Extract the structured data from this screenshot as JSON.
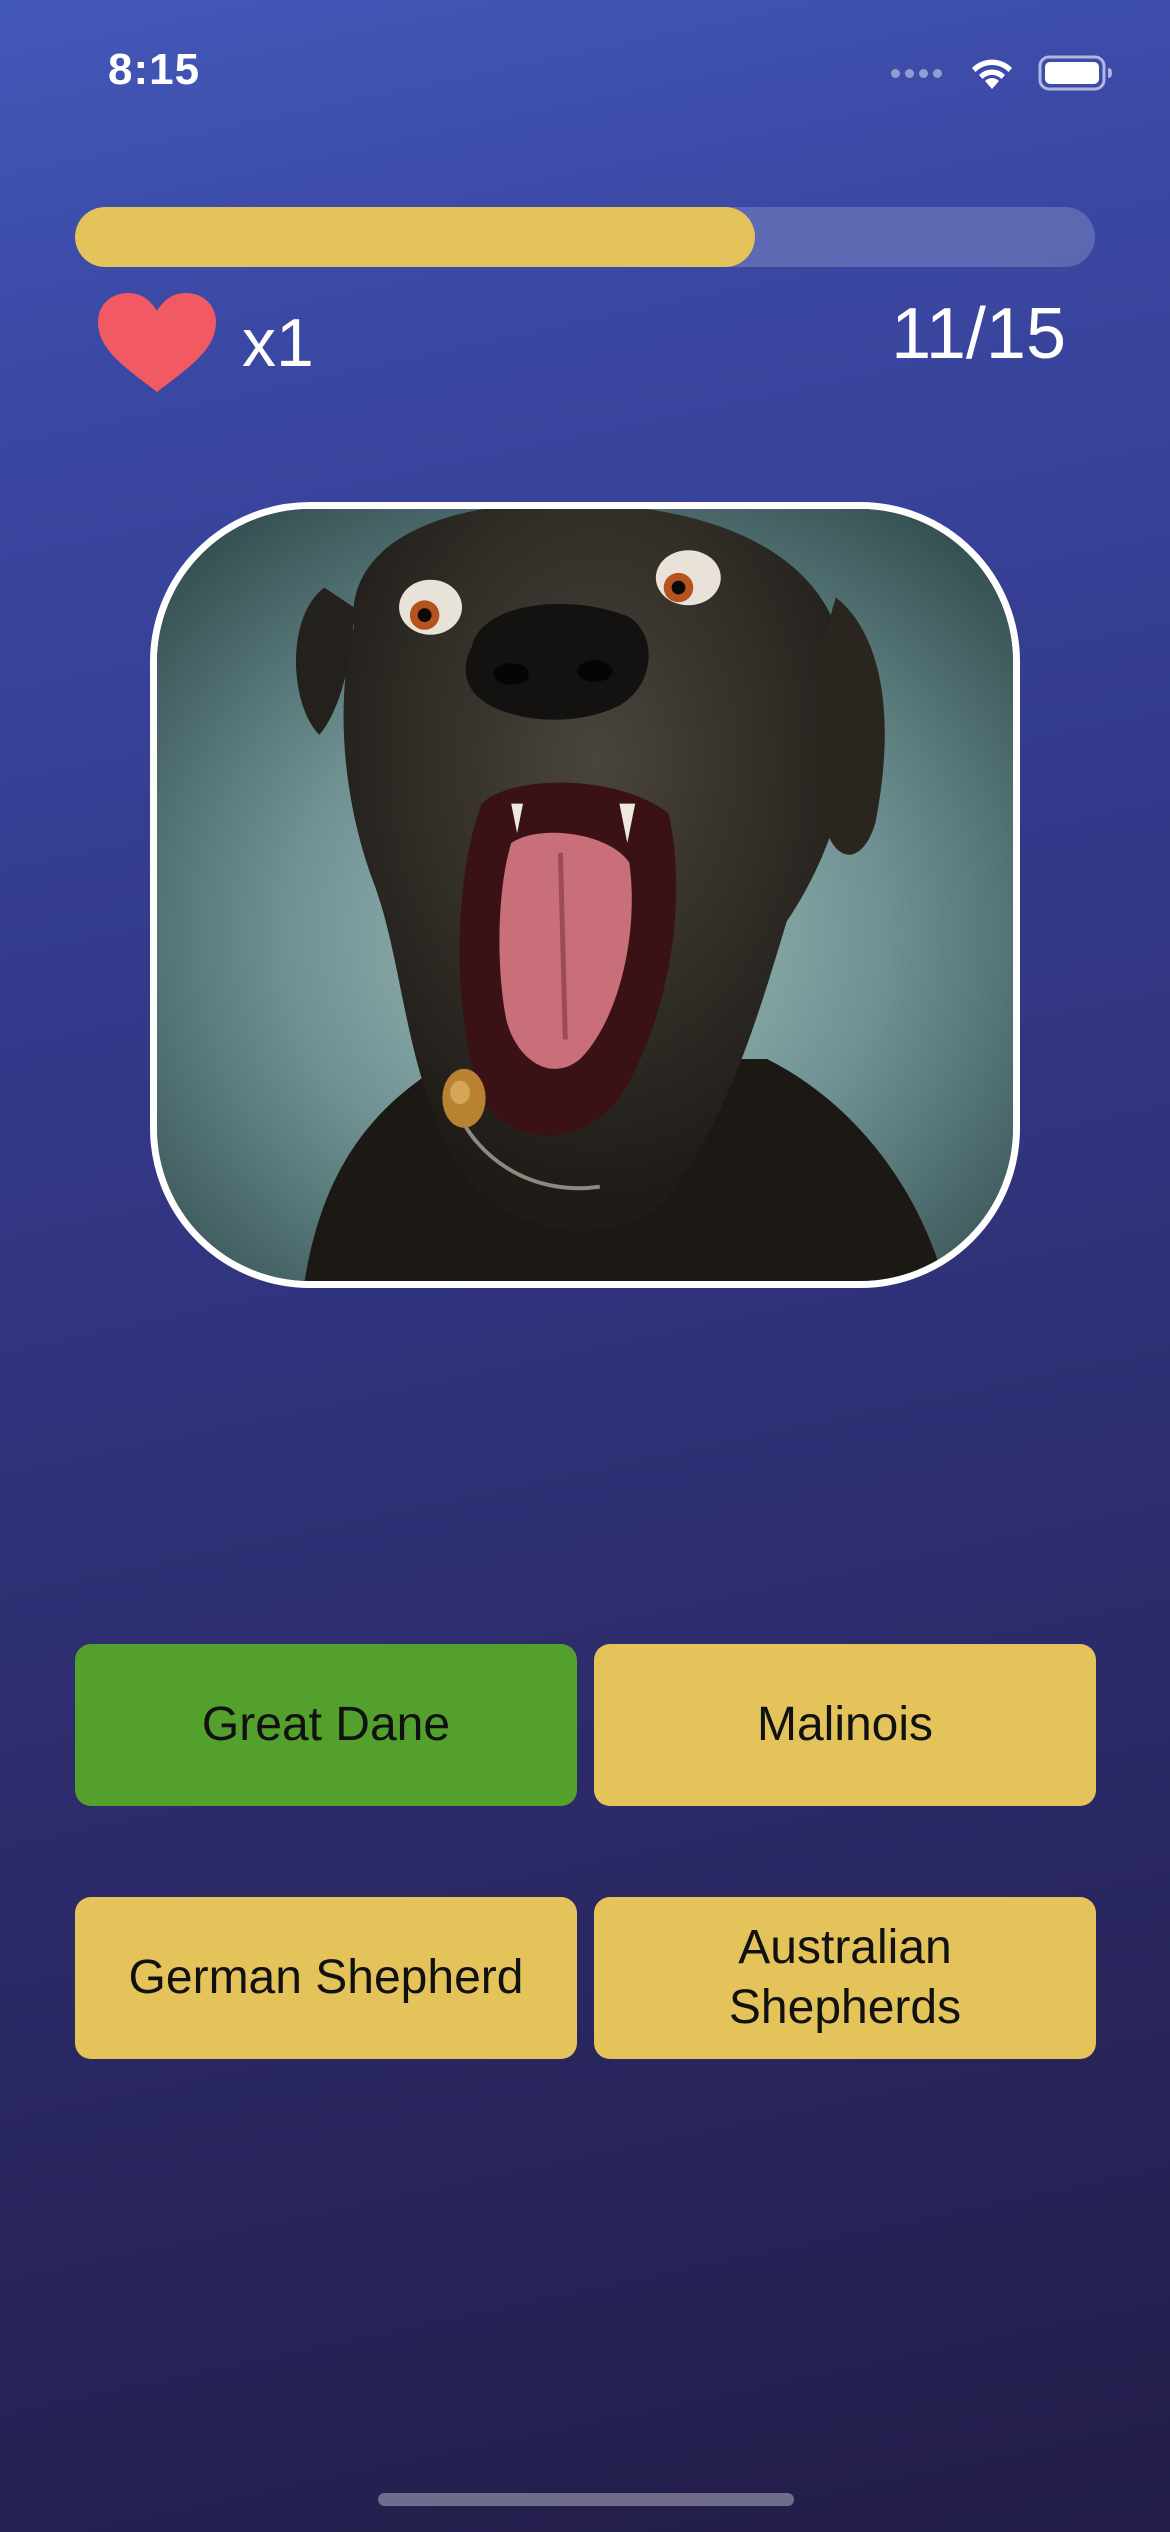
{
  "status_bar": {
    "time": "8:15",
    "icons": [
      "signal-dots-icon",
      "wifi-icon",
      "battery-icon"
    ]
  },
  "progress": {
    "fraction": 0.667,
    "color": "#e4c35a"
  },
  "lives": {
    "icon": "heart-icon",
    "count_label": "x1",
    "heart_color": "#f25a63"
  },
  "question_counter": "11/15",
  "photo": {
    "subject": "dog-photo"
  },
  "answers": [
    {
      "label": "Great Dane",
      "state": "correct",
      "color": "#53a02c"
    },
    {
      "label": "Malinois",
      "state": "default",
      "color": "#e4c35a"
    },
    {
      "label": "German Shepherd",
      "state": "default",
      "color": "#e4c35a"
    },
    {
      "label": "Australian Shepherds",
      "state": "default",
      "color": "#e4c35a"
    }
  ]
}
